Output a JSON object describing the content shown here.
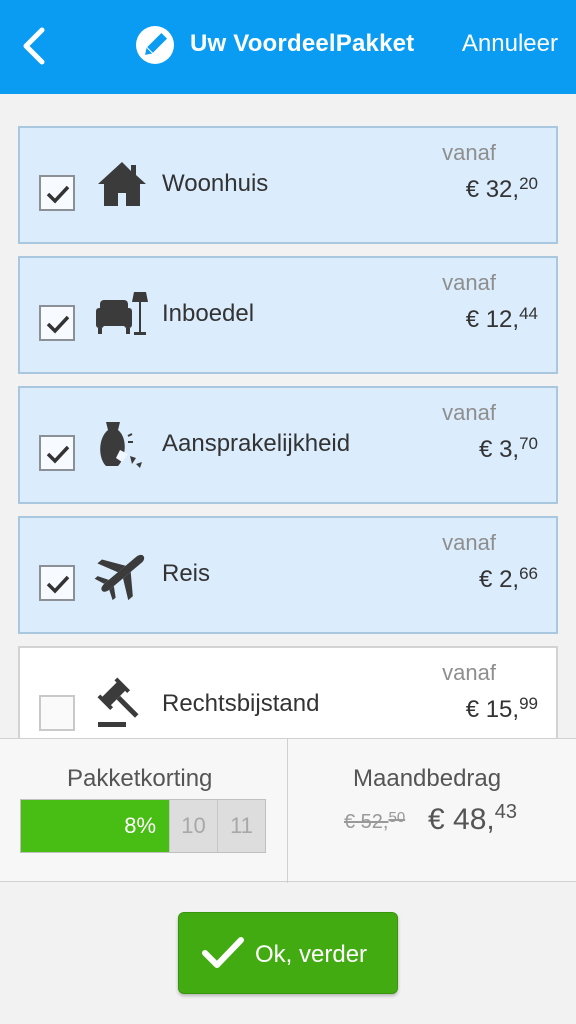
{
  "header": {
    "title": "Uw VoordeelPakket",
    "cancel_label": "Annuleer",
    "back_icon": "chevron-left-icon",
    "edit_icon": "pencil-icon",
    "background": "#0a9cf2"
  },
  "cards": [
    {
      "label": "Woonhuis",
      "vanaf": "vanaf",
      "price_main": "€ 32,",
      "price_cents": "20",
      "checked": true,
      "icon": "house-icon"
    },
    {
      "label": "Inboedel",
      "vanaf": "vanaf",
      "price_main": "€ 12,",
      "price_cents": "44",
      "checked": true,
      "icon": "armchair-lamp-icon"
    },
    {
      "label": "Aansprakelijkheid",
      "vanaf": "vanaf",
      "price_main": "€ 3,",
      "price_cents": "70",
      "checked": true,
      "icon": "broken-vase-icon"
    },
    {
      "label": "Reis",
      "vanaf": "vanaf",
      "price_main": "€ 2,",
      "price_cents": "66",
      "checked": true,
      "icon": "airplane-icon"
    },
    {
      "label": "Rechtsbijstand",
      "vanaf": "vanaf",
      "price_main": "€ 15,",
      "price_cents": "99",
      "checked": false,
      "icon": "gavel-icon"
    }
  ],
  "summary": {
    "discount_label": "Pakketkorting",
    "discount_value": "8%",
    "discount_fraction": 0.61,
    "discount_steps": [
      "10",
      "11"
    ],
    "monthly_label": "Maandbedrag",
    "old_main": "€ 52,",
    "old_cents": "50",
    "new_main": "€ 48,",
    "new_cents": "43"
  },
  "ok_button": {
    "label": "Ok, verder",
    "icon": "checkmark-icon",
    "color": "#43ab12"
  }
}
